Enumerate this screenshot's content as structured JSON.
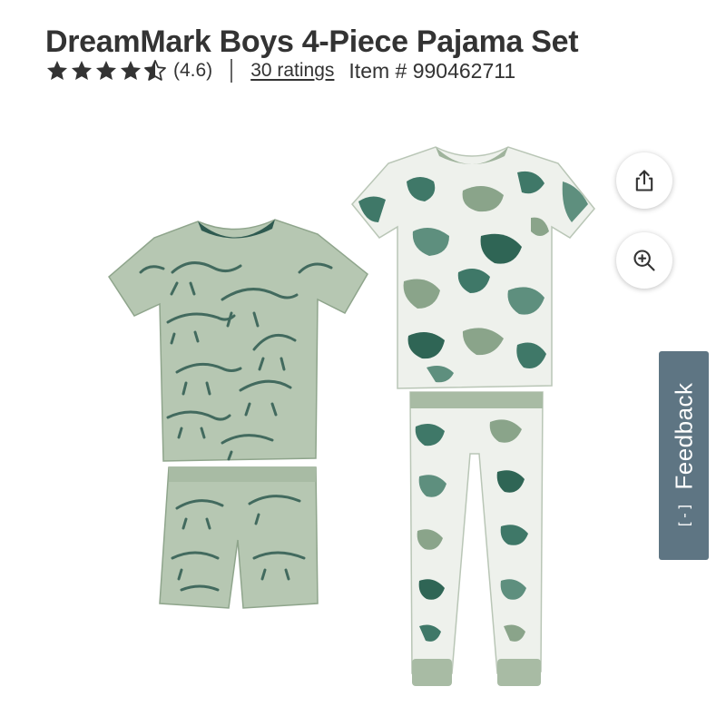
{
  "product": {
    "title": "DreamMark Boys 4-Piece Pajama Set",
    "rating_value": "(4.6)",
    "rating_stars": 4.6,
    "ratings_link": "30 ratings",
    "item_number": "Item # 990462711"
  },
  "actions": {
    "share_icon": "share-icon",
    "zoom_icon": "zoom-in-icon"
  },
  "feedback": {
    "icon": "[-]",
    "label": "Feedback"
  },
  "colors": {
    "text": "#333333",
    "star": "#333333",
    "feedback_bg": "#5e7583",
    "sage": "#b6c7b2",
    "teal_dark": "#2e5a50",
    "camo_dark": "#3f7868"
  }
}
